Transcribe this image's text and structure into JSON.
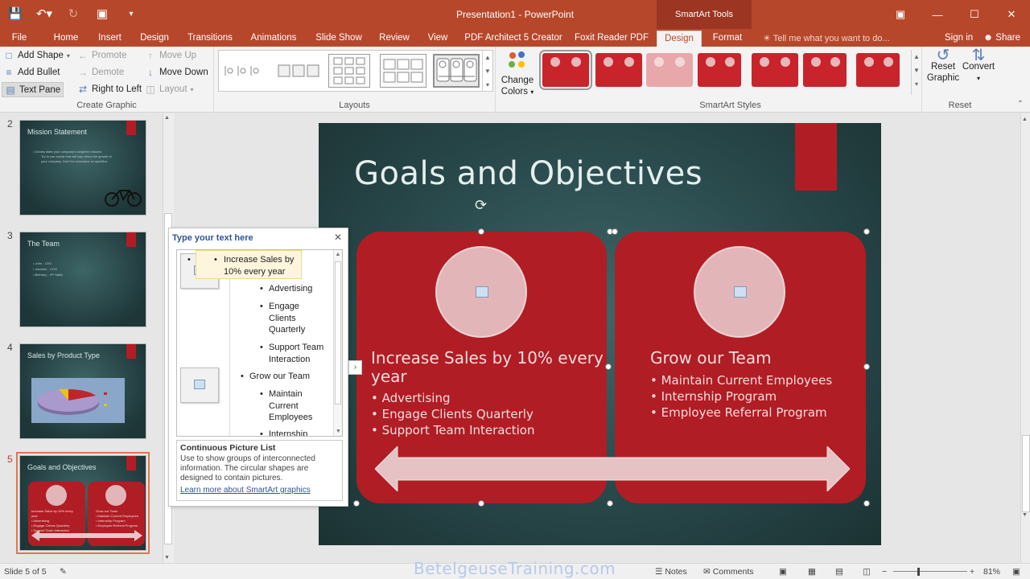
{
  "window": {
    "title": "Presentation1 - PowerPoint",
    "contextual_tools": "SmartArt Tools"
  },
  "tabs": [
    "File",
    "Home",
    "Insert",
    "Design",
    "Transitions",
    "Animations",
    "Slide Show",
    "Review",
    "View",
    "PDF Architect 5 Creator",
    "Foxit Reader PDF",
    "Design",
    "Format"
  ],
  "active_tab": "Design",
  "tell_me": "Tell me what you want to do...",
  "sign_in": "Sign in",
  "share": "Share",
  "ribbon": {
    "create_graphic": {
      "label": "Create Graphic",
      "add_shape": "Add Shape",
      "add_bullet": "Add Bullet",
      "text_pane": "Text Pane",
      "promote": "Promote",
      "demote": "Demote",
      "right_to_left": "Right to Left",
      "move_up": "Move Up",
      "move_down": "Move Down",
      "layout": "Layout"
    },
    "layouts": {
      "label": "Layouts"
    },
    "change_colors": {
      "line1": "Change",
      "line2": "Colors"
    },
    "smartart_styles": {
      "label": "SmartArt Styles"
    },
    "reset": {
      "label": "Reset",
      "reset_graphic_1": "Reset",
      "reset_graphic_2": "Graphic",
      "convert": "Convert"
    }
  },
  "slides": [
    {
      "num": "2",
      "title": "Mission Statement",
      "lines": [
        "• Clearly state your company's longterm mission.",
        "Try to use words that will help direct the growth of",
        "your company. Don't be excessive so specifics."
      ]
    },
    {
      "num": "3",
      "title": "The Team",
      "lines": [
        "• John - CEO",
        "• Jasmine - COO",
        "• Bethany - VP Sales"
      ]
    },
    {
      "num": "4",
      "title": "Sales by Product Type",
      "lines": []
    },
    {
      "num": "5",
      "title": "Goals and Objectives",
      "lines": []
    }
  ],
  "current_slide": {
    "title": "Goals and Objectives",
    "left": {
      "heading": "Increase Sales by 10% every year",
      "bullets": [
        "• Advertising",
        "• Engage Clients Quarterly",
        "• Support Team Interaction"
      ]
    },
    "right": {
      "heading": "Grow our Team",
      "bullets": [
        "• Maintain Current Employees",
        "• Internship Program",
        "• Employee Referral Program"
      ]
    }
  },
  "text_pane": {
    "title": "Type your text here",
    "items": [
      {
        "level": 1,
        "text": "Increase Sales by 10% every year"
      },
      {
        "level": 2,
        "text": "Advertising"
      },
      {
        "level": 2,
        "text": "Engage Clients Quarterly"
      },
      {
        "level": 2,
        "text": "Support Team Interaction"
      },
      {
        "level": 1,
        "text": "Grow our Team"
      },
      {
        "level": 2,
        "text": "Maintain Current Employees"
      },
      {
        "level": 2,
        "text": "Internship"
      }
    ],
    "desc_title": "Continuous Picture List",
    "desc_text": "Use to show groups of interconnected information. The circular shapes are designed to contain pictures.",
    "desc_link": "Learn more about SmartArt graphics"
  },
  "status": {
    "slide": "Slide 5 of 5",
    "notes": "Notes",
    "comments": "Comments",
    "zoom": "81%"
  },
  "watermark": "BetelgeuseTraining.com",
  "colors": {
    "brand": "#b7472a",
    "accent": "#b11d25"
  }
}
